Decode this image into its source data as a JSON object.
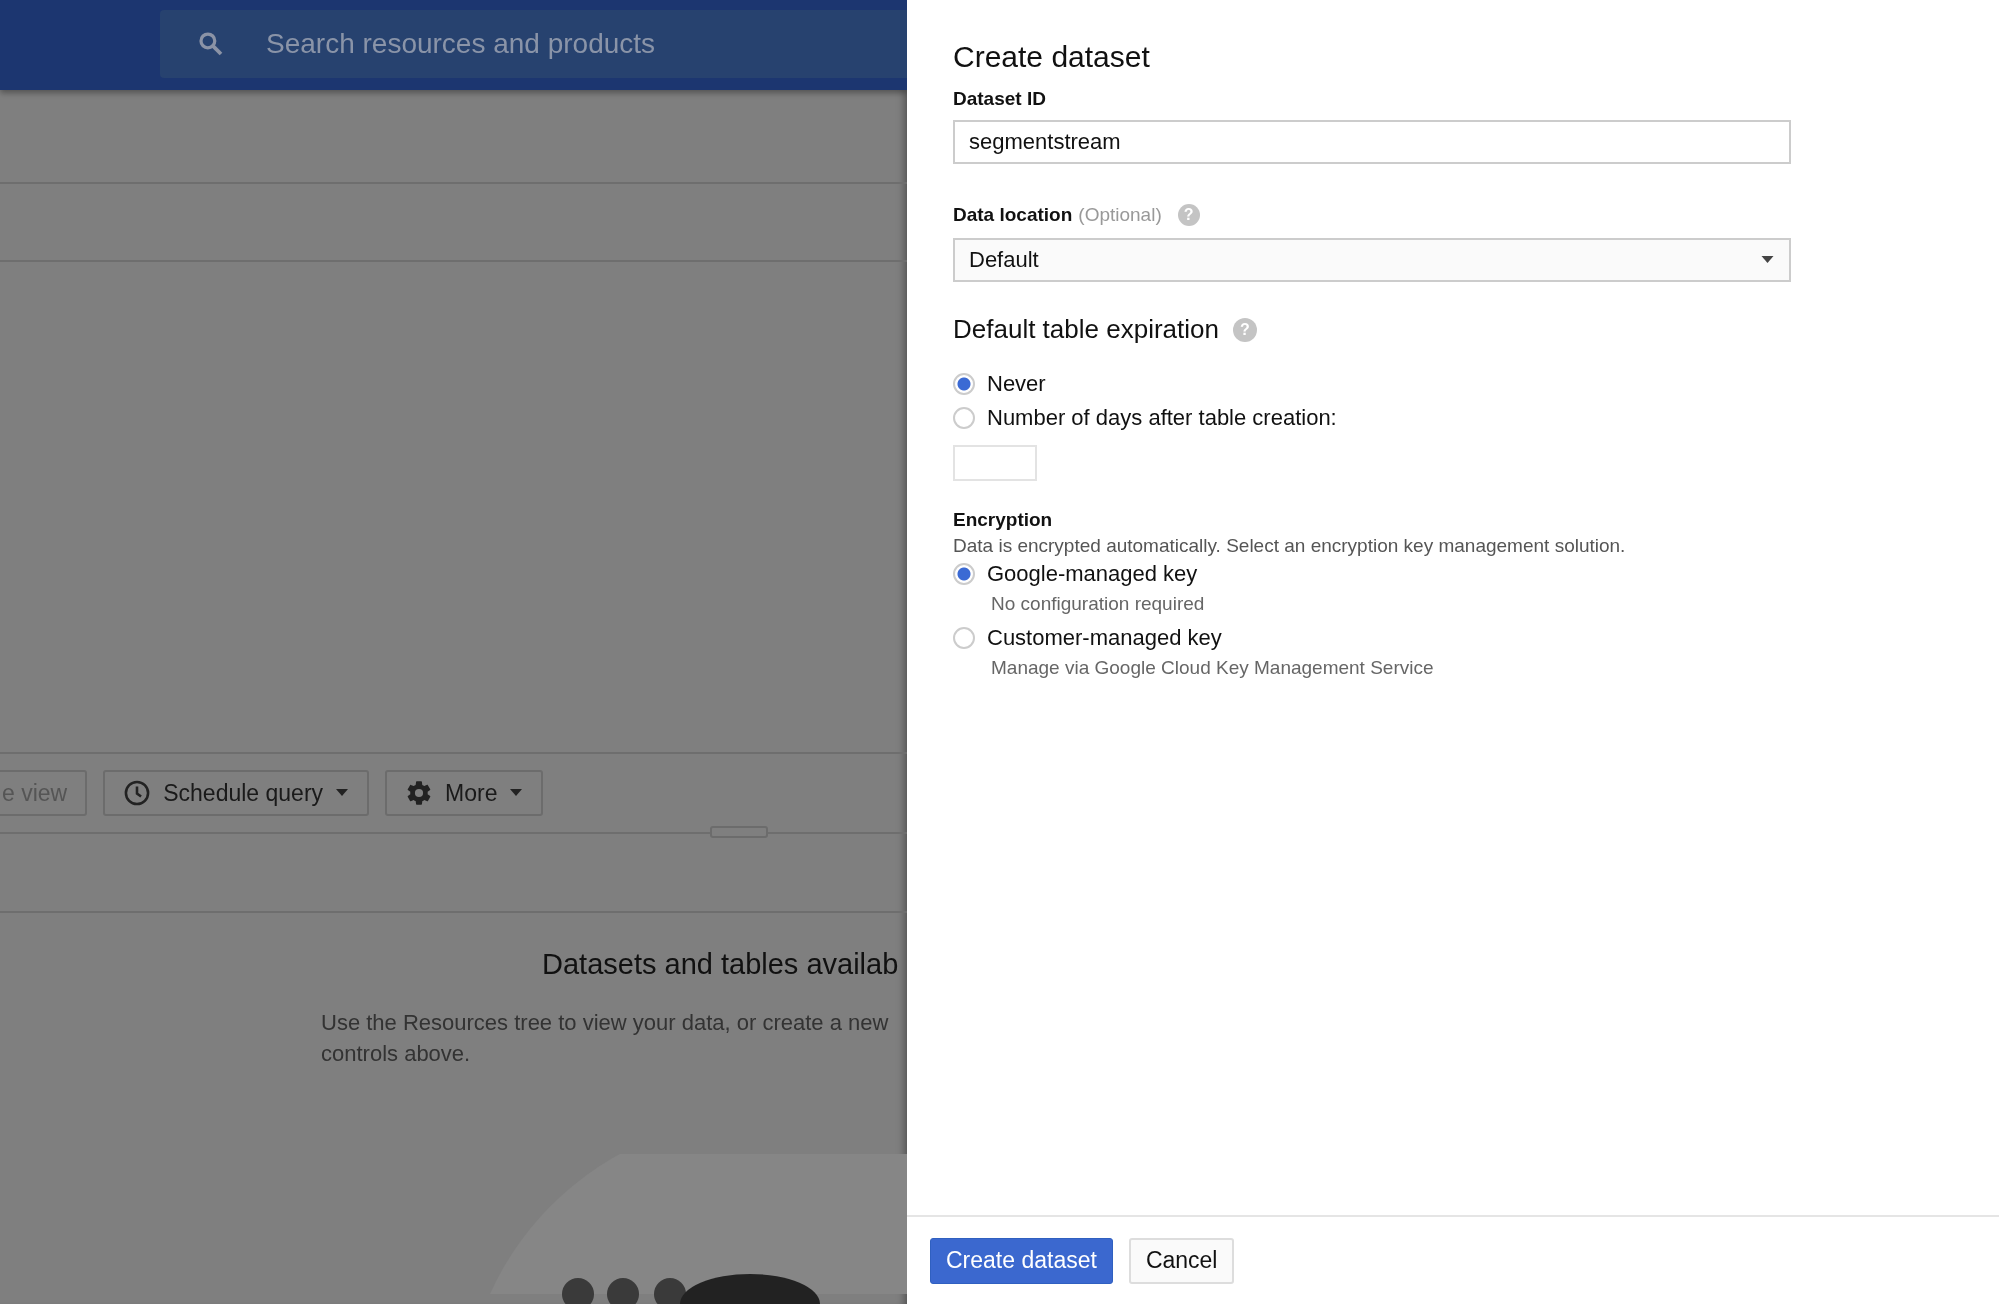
{
  "background": {
    "search": {
      "placeholder": "Search resources and products"
    },
    "toolbar": [
      {
        "label": "e view",
        "kind": "plain",
        "disabled": true
      },
      {
        "label": "Schedule query",
        "kind": "schedule",
        "disabled": false
      },
      {
        "label": "More",
        "kind": "menu",
        "disabled": false
      }
    ],
    "empty_state": {
      "title": "Datasets and tables availab",
      "lines": [
        "Use the Resources tree to view your data, or create a new",
        "controls above."
      ]
    }
  },
  "panel": {
    "title": "Create dataset",
    "dataset_id": {
      "label": "Dataset ID",
      "value": "segmentstream"
    },
    "data_location": {
      "label": "Data location",
      "optional": "(Optional)",
      "help": "?",
      "value": "Default"
    },
    "expiration": {
      "title": "Default table expiration",
      "help": "?",
      "options": [
        {
          "label": "Never",
          "selected": true
        },
        {
          "label": "Number of days after table creation:",
          "selected": false
        }
      ]
    },
    "encryption": {
      "title": "Encryption",
      "description": "Data is encrypted automatically. Select an encryption key management solution.",
      "options": [
        {
          "label": "Google-managed key",
          "sublabel": "No configuration required",
          "selected": true
        },
        {
          "label": "Customer-managed key",
          "sublabel": "Manage via Google Cloud Key Management Service",
          "selected": false
        }
      ]
    },
    "buttons": [
      {
        "label": "Create dataset",
        "kind": "primary"
      },
      {
        "label": "Cancel",
        "kind": "secondary"
      }
    ]
  }
}
